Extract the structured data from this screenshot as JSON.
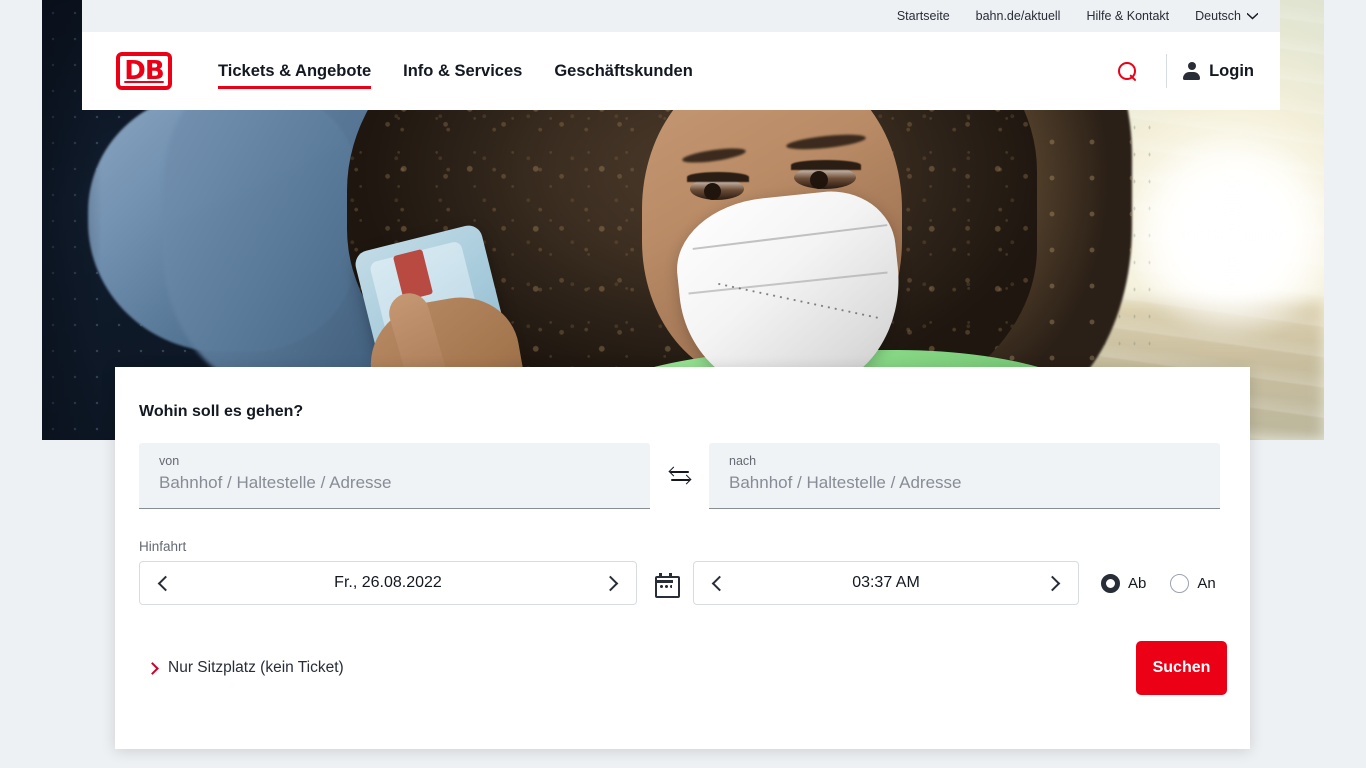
{
  "utility": {
    "links": [
      {
        "label": "Startseite"
      },
      {
        "label": "bahn.de/aktuell"
      },
      {
        "label": "Hilfe & Kontakt"
      }
    ],
    "language": "Deutsch"
  },
  "header": {
    "logo_text": "DB",
    "nav": [
      {
        "label": "Tickets & Angebote",
        "active": true
      },
      {
        "label": "Info & Services",
        "active": false
      },
      {
        "label": "Geschäftskunden",
        "active": false
      }
    ],
    "search_icon": "search-icon",
    "login_label": "Login",
    "login_icon": "person-icon"
  },
  "search_card": {
    "title": "Wohin soll es gehen?",
    "from": {
      "label": "von",
      "value": "",
      "placeholder": "Bahnhof / Haltestelle / Adresse"
    },
    "to": {
      "label": "nach",
      "value": "",
      "placeholder": "Bahnhof / Haltestelle / Adresse"
    },
    "swap_icon": "swap-arrows-icon",
    "trip_label": "Hinfahrt",
    "date": {
      "value": "Fr., 26.08.2022",
      "prev_icon": "chevron-left-icon",
      "next_icon": "chevron-right-icon"
    },
    "calendar_icon": "calendar-icon",
    "time": {
      "value": "03:37 AM",
      "prev_icon": "chevron-left-icon",
      "next_icon": "chevron-right-icon"
    },
    "radios": [
      {
        "label": "Ab",
        "selected": true
      },
      {
        "label": "An",
        "selected": false
      }
    ],
    "seat_link": "Nur Sitzplatz (kein Ticket)",
    "submit_label": "Suchen"
  },
  "colors": {
    "brand_red": "#EC0016",
    "link_red": "#C9002B",
    "text_dark": "#131821",
    "text_muted": "#646973",
    "page_bg": "#EEF1F4",
    "field_bg": "#F0F3F5"
  }
}
